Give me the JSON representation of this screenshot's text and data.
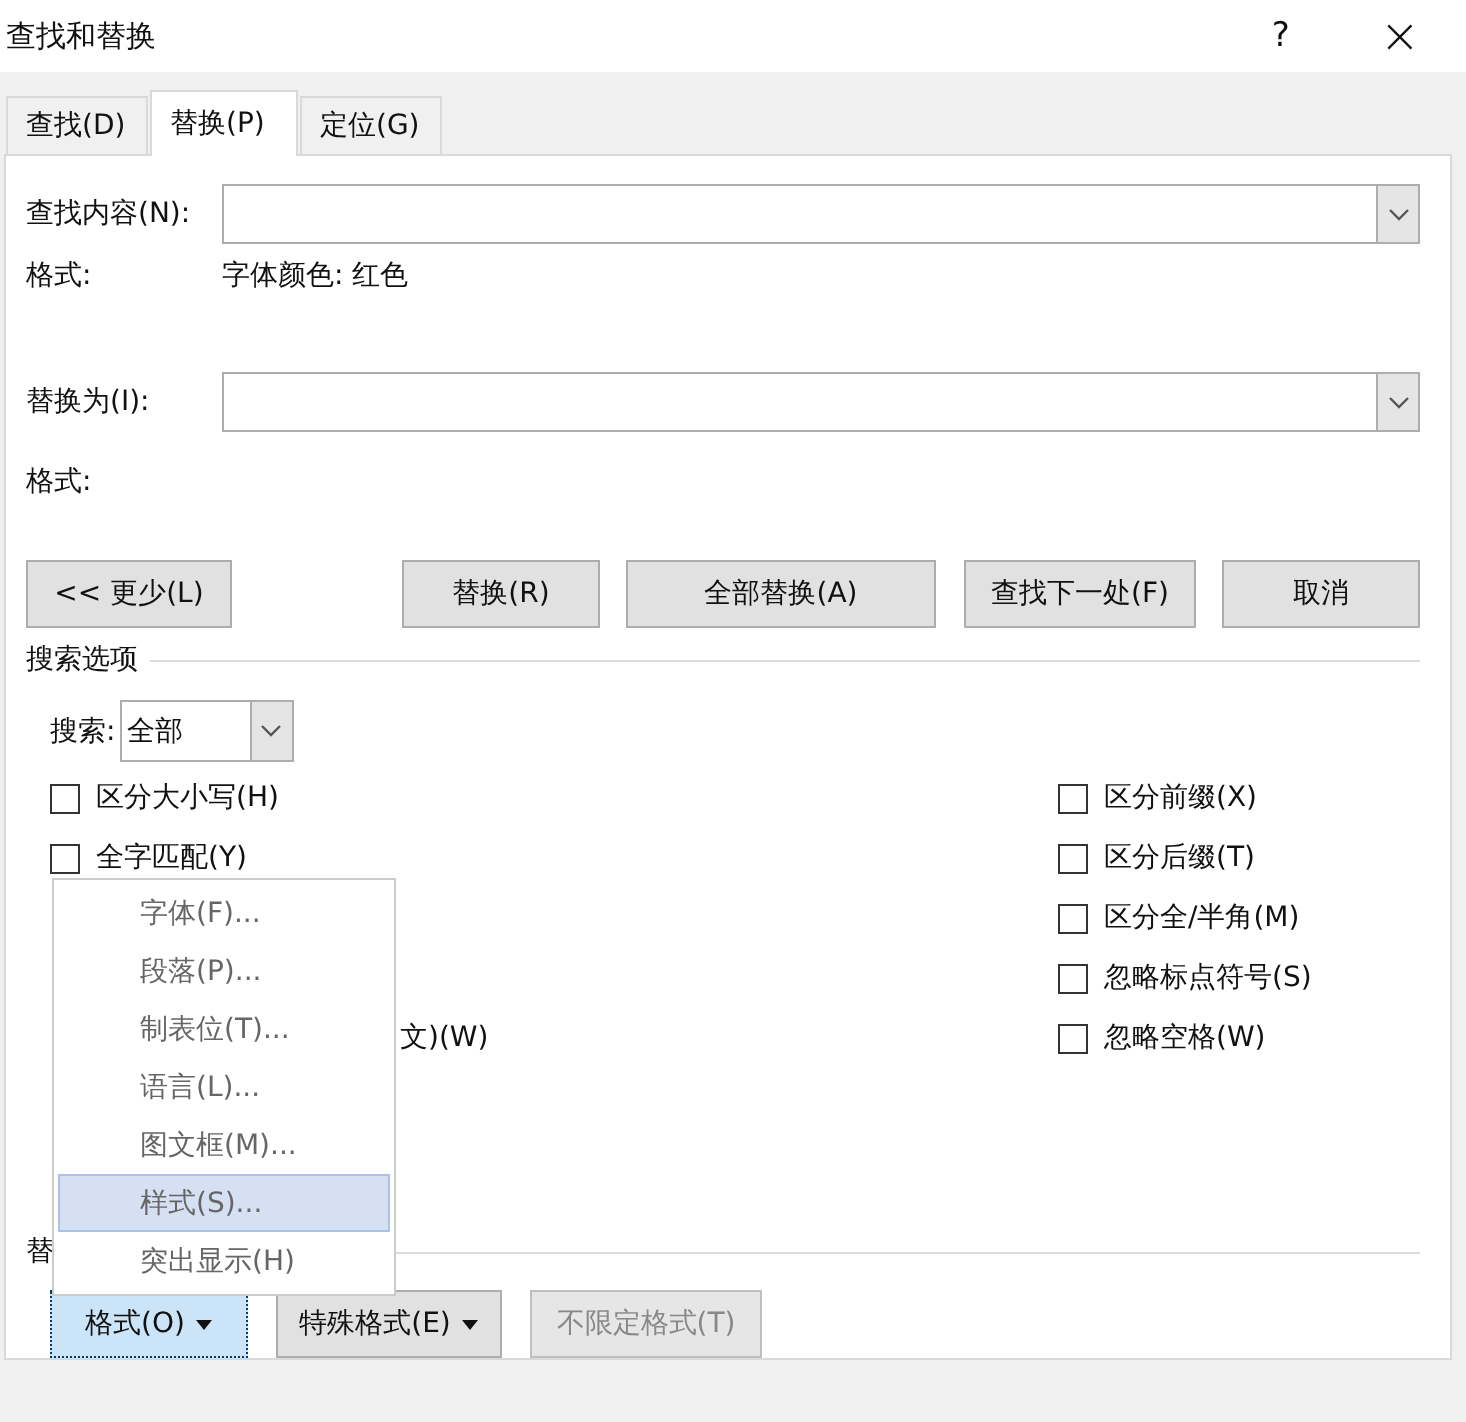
{
  "window": {
    "title": "查找和替换",
    "help": "?",
    "close": "×"
  },
  "tabs": [
    {
      "label": "查找(D)",
      "selected": false
    },
    {
      "label": "替换(P)",
      "selected": true
    },
    {
      "label": "定位(G)",
      "selected": false
    }
  ],
  "find": {
    "label": "查找内容(N):",
    "format_label": "格式:",
    "format_value": "字体颜色: 红色"
  },
  "replace": {
    "label": "替换为(I):",
    "format_label": "格式:"
  },
  "buttons": [
    {
      "label": "<< 更少(L)"
    },
    {
      "label": "替换(R)"
    },
    {
      "label": "全部替换(A)"
    },
    {
      "label": "查找下一处(F)"
    },
    {
      "label": "取消"
    }
  ],
  "search_options": {
    "title": "搜索选项",
    "search_label": "搜索:",
    "search_value": "全部"
  },
  "options_left": [
    {
      "kind": "checkbox",
      "label": "区分大小写(H)",
      "checked": false
    },
    {
      "kind": "checkbox",
      "label": "全字匹配(Y)",
      "checked": false
    },
    {
      "kind": "hidden"
    },
    {
      "kind": "hidden"
    },
    {
      "kind": "partial",
      "label": "文)(W)"
    }
  ],
  "options_right": [
    {
      "kind": "checkbox",
      "label": "区分前缀(X)",
      "checked": false
    },
    {
      "kind": "checkbox",
      "label": "区分后缀(T)",
      "checked": false
    },
    {
      "kind": "checkbox",
      "label": "区分全/半角(M)",
      "checked": false
    },
    {
      "kind": "checkbox",
      "label": "忽略标点符号(S)",
      "checked": false
    },
    {
      "kind": "checkbox",
      "label": "忽略空格(W)",
      "checked": false
    }
  ],
  "replace_section": {
    "title": "替"
  },
  "format_menu": [
    {
      "label": "字体(F)...",
      "selected": false
    },
    {
      "label": "段落(P)...",
      "selected": false
    },
    {
      "label": "制表位(T)...",
      "selected": false
    },
    {
      "label": "语言(L)...",
      "selected": false
    },
    {
      "label": "图文框(M)...",
      "selected": false
    },
    {
      "label": "样式(S)...",
      "selected": true
    },
    {
      "label": "突出显示(H)",
      "selected": false
    }
  ],
  "bottom_buttons": [
    {
      "label": "格式(O)",
      "kind": "dropdown",
      "pressed": true,
      "disabled": false
    },
    {
      "label": "特殊格式(E)",
      "kind": "dropdown",
      "pressed": false,
      "disabled": false
    },
    {
      "label": "不限定格式(T)",
      "kind": "plain",
      "pressed": false,
      "disabled": true
    }
  ]
}
